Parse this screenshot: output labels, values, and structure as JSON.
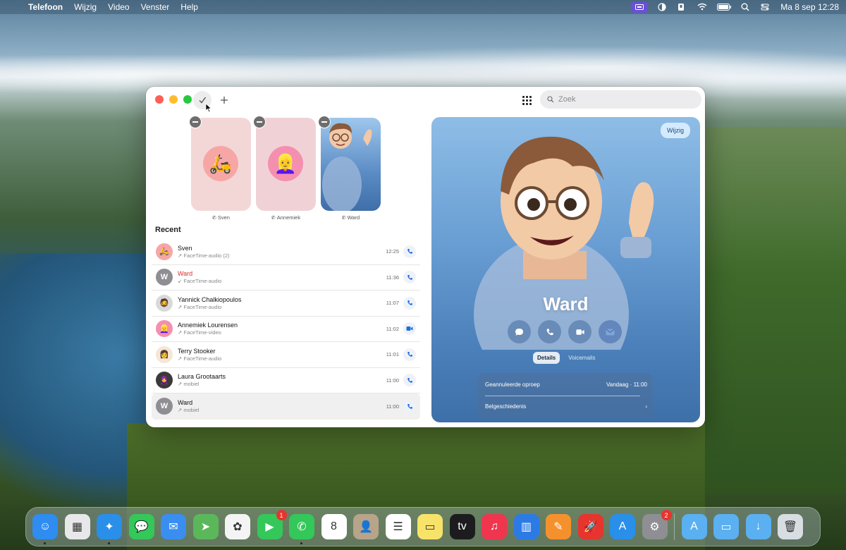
{
  "menubar": {
    "app_name": "Telefoon",
    "menus": [
      "Wijzig",
      "Video",
      "Venster",
      "Help"
    ],
    "clock": "Ma 8 sep  12:28"
  },
  "toolbar": {
    "done_icon": "checkmark",
    "add_icon": "plus",
    "search_placeholder": "Zoek"
  },
  "favorites": [
    {
      "name": "Sven",
      "emoji": "🛵"
    },
    {
      "name": "Annemiek",
      "emoji": "👱‍♀️"
    },
    {
      "name": "Ward",
      "emoji": "🧑"
    }
  ],
  "recent": {
    "title": "Recent",
    "items": [
      {
        "name": "Sven",
        "sub": "↗ FaceTime-audio (2)",
        "time": "12:25",
        "missed": false,
        "avatar": "🛵",
        "avatar_bg": "#f7a6a6",
        "action": "phone"
      },
      {
        "name": "Ward",
        "sub": "↙ FaceTime-audio",
        "time": "11:36",
        "missed": true,
        "avatar": "W",
        "avatar_bg": "#8e8e93",
        "action": "phone"
      },
      {
        "name": "Yannick Chalkiopoulos",
        "sub": "↗ FaceTime-audio",
        "time": "11:07",
        "missed": false,
        "avatar": "🧔",
        "avatar_bg": "#d9d9d9",
        "action": "phone"
      },
      {
        "name": "Annemiek Lourensen",
        "sub": "↗ FaceTime-video",
        "time": "11:02",
        "missed": false,
        "avatar": "👱‍♀️",
        "avatar_bg": "#f58fb0",
        "action": "video"
      },
      {
        "name": "Terry Stooker",
        "sub": "↗ FaceTime-audio",
        "time": "11:01",
        "missed": false,
        "avatar": "👩",
        "avatar_bg": "#f5e6d6",
        "action": "phone"
      },
      {
        "name": "Laura Grootaarts",
        "sub": "↗ mobiel",
        "time": "11:00",
        "missed": false,
        "avatar": "🧕",
        "avatar_bg": "#3a3a3a",
        "action": "phone"
      },
      {
        "name": "Ward",
        "sub": "↗ mobiel",
        "time": "11:00",
        "missed": false,
        "avatar": "W",
        "avatar_bg": "#8e8e93",
        "action": "phone"
      }
    ]
  },
  "detail": {
    "edit_label": "Wijzig",
    "name": "Ward",
    "tabs": [
      "Details",
      "Voicemails"
    ],
    "active_tab": "Details",
    "info": {
      "row1_label": "Geannuleerde oproep",
      "row1_value": "Vandaag · 11:00",
      "row2_label": "Belgeschiedenis",
      "row2_chevron": "›"
    }
  },
  "dock": {
    "apps": [
      {
        "name": "finder",
        "bg": "#2f8cf0",
        "glyph": "☺",
        "running": true
      },
      {
        "name": "launchpad",
        "bg": "#e8e8ea",
        "glyph": "▦",
        "running": false
      },
      {
        "name": "safari",
        "bg": "#2a8fe8",
        "glyph": "✦",
        "running": true
      },
      {
        "name": "messages",
        "bg": "#34c759",
        "glyph": "💬",
        "running": false
      },
      {
        "name": "mail",
        "bg": "#3a8ef0",
        "glyph": "✉",
        "running": false
      },
      {
        "name": "maps",
        "bg": "#5ab85a",
        "glyph": "➤",
        "running": false
      },
      {
        "name": "photos",
        "bg": "#f4f4f4",
        "glyph": "✿",
        "running": false
      },
      {
        "name": "facetime",
        "bg": "#34c759",
        "glyph": "▶",
        "running": false,
        "badge": "1"
      },
      {
        "name": "phone",
        "bg": "#34c759",
        "glyph": "✆",
        "running": true
      },
      {
        "name": "calendar",
        "bg": "#ffffff",
        "glyph": "8",
        "running": false
      },
      {
        "name": "contacts",
        "bg": "#b8a48a",
        "glyph": "👤",
        "running": false
      },
      {
        "name": "reminders",
        "bg": "#ffffff",
        "glyph": "☰",
        "running": false
      },
      {
        "name": "notes",
        "bg": "#f8e36a",
        "glyph": "▭",
        "running": false
      },
      {
        "name": "apple-tv",
        "bg": "#1c1c1e",
        "glyph": "tv",
        "running": false
      },
      {
        "name": "music",
        "bg": "#f0364e",
        "glyph": "♫",
        "running": false
      },
      {
        "name": "keynote",
        "bg": "#2c7be5",
        "glyph": "▥",
        "running": false
      },
      {
        "name": "pages",
        "bg": "#f5912c",
        "glyph": "✎",
        "running": false
      },
      {
        "name": "rocket",
        "bg": "#e5352e",
        "glyph": "🚀",
        "running": false
      },
      {
        "name": "app-store",
        "bg": "#2a8fe8",
        "glyph": "A",
        "running": false
      },
      {
        "name": "system-settings",
        "bg": "#8e8e93",
        "glyph": "⚙",
        "running": false,
        "badge": "2"
      }
    ],
    "folders": [
      {
        "name": "applications-folder",
        "bg": "#5ab0f0",
        "glyph": "A"
      },
      {
        "name": "documents-folder",
        "bg": "#5ab0f0",
        "glyph": "▭"
      },
      {
        "name": "downloads-folder",
        "bg": "#5ab0f0",
        "glyph": "↓"
      },
      {
        "name": "trash",
        "bg": "#d8dde2",
        "glyph": "🗑"
      }
    ]
  }
}
